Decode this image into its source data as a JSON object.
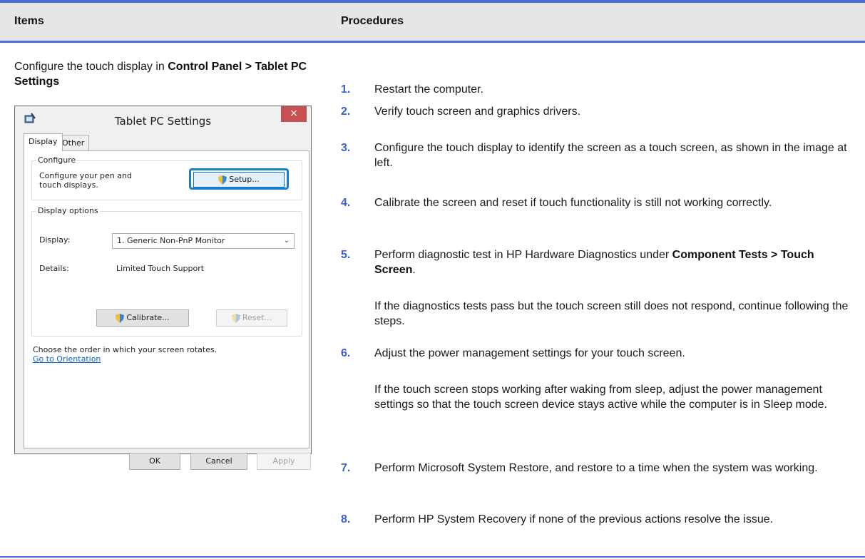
{
  "header": {
    "items": "Items",
    "procedures": "Procedures"
  },
  "items_cell": {
    "text_pre": "Configure the touch display in ",
    "bold": "Control Panel > Tablet PC Settings"
  },
  "dialog": {
    "title": "Tablet PC Settings",
    "close": "×",
    "tabs": [
      "Display",
      "Other"
    ],
    "configure_group": "Configure",
    "configure_text": "Configure your pen and touch displays.",
    "setup_button": "Setup...",
    "display_options_group": "Display options",
    "display_label": "Display:",
    "display_value": "1. Generic Non-PnP Monitor",
    "details_label": "Details:",
    "details_value": "Limited Touch Support",
    "calibrate_button": "Calibrate...",
    "reset_button": "Reset...",
    "rotate_text": "Choose the order in which your screen rotates.",
    "orientation_link": "Go to Orientation",
    "ok_button": "OK",
    "cancel_button": "Cancel",
    "apply_button": "Apply"
  },
  "steps": [
    {
      "num": "1.",
      "text": "Restart the computer."
    },
    {
      "num": "2.",
      "text": "Verify touch screen and graphics drivers."
    },
    {
      "num": "3.",
      "text": "Configure the touch display to identify the screen as a touch screen, as shown in the image at left."
    },
    {
      "num": "4.",
      "text": "Calibrate the screen and reset if touch functionality is still not working correctly."
    },
    {
      "num": "5.",
      "text_pre": "Perform diagnostic test in HP Hardware Diagnostics under ",
      "bold": "Component Tests > Touch Screen",
      "text_post": ".",
      "note": "If the diagnostics tests pass but the touch screen still does not respond, continue following the steps."
    },
    {
      "num": "6.",
      "text": "Adjust the power management settings for your touch screen.",
      "note": "If the touch screen stops working after waking from sleep, adjust the power management settings so that the touch screen device stays active while the computer is in Sleep mode."
    },
    {
      "num": "7.",
      "text": "Perform Microsoft System Restore, and restore to a time when the system was working."
    },
    {
      "num": "8.",
      "text": "Perform HP System Recovery if none of the previous actions resolve the issue."
    }
  ],
  "colors": {
    "accent": "#4a6fd4",
    "number": "#3a5fd0",
    "header_bg": "#e6e6e6",
    "focus": "#1c7ec7",
    "close_red": "#c75050"
  }
}
